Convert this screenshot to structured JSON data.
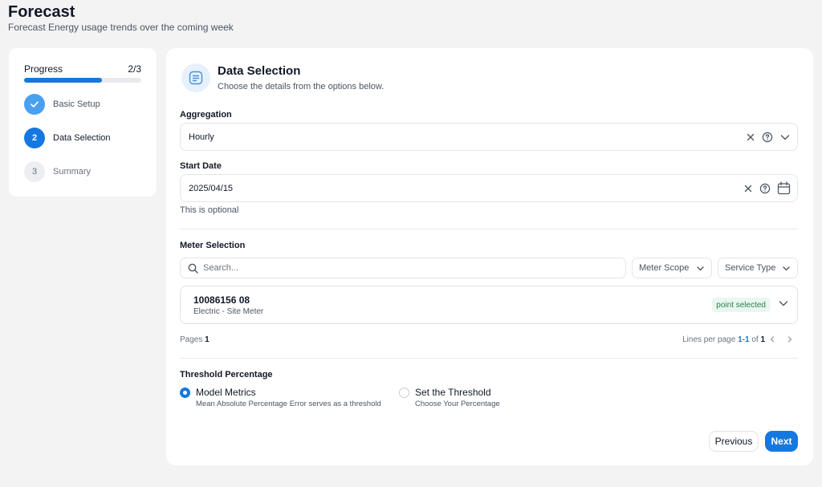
{
  "page": {
    "title": "Forecast",
    "subtitle": "Forecast Energy usage trends over the coming week"
  },
  "progress": {
    "label": "Progress",
    "count": "2/3",
    "fraction": 0.667,
    "steps": [
      {
        "number": "",
        "label": "Basic Setup",
        "state": "done"
      },
      {
        "number": "2",
        "label": "Data Selection",
        "state": "current"
      },
      {
        "number": "3",
        "label": "Summary",
        "state": "todo"
      }
    ]
  },
  "section": {
    "title": "Data Selection",
    "subtitle": "Choose the details from the options below."
  },
  "aggregation": {
    "label": "Aggregation",
    "value": "Hourly"
  },
  "start_date": {
    "label": "Start Date",
    "value": "2025/04/15",
    "hint": "This is optional"
  },
  "meter_selection": {
    "label": "Meter Selection",
    "search_placeholder": "Search...",
    "filters": [
      "Meter Scope",
      "Service Type"
    ],
    "meters": [
      {
        "id": "10086156 08",
        "description": "Electric - Site Meter",
        "badge": "point selected"
      }
    ],
    "pagination": {
      "pages_label": "Pages",
      "pages_value": "1",
      "lines_label": "Lines per page",
      "range": "1-1",
      "of_label": "of",
      "total": "1"
    }
  },
  "threshold": {
    "label": "Threshold Percentage",
    "options": [
      {
        "title": "Model Metrics",
        "description": "Mean Absolute Percentage Error serves as a threshold",
        "selected": true
      },
      {
        "title": "Set the Threshold",
        "description": "Choose Your Percentage",
        "selected": false
      }
    ]
  },
  "actions": {
    "previous": "Previous",
    "next": "Next"
  },
  "colors": {
    "accent": "#1578e0",
    "badge_bg": "#e9f7ef",
    "badge_text": "#2e7d4f"
  }
}
